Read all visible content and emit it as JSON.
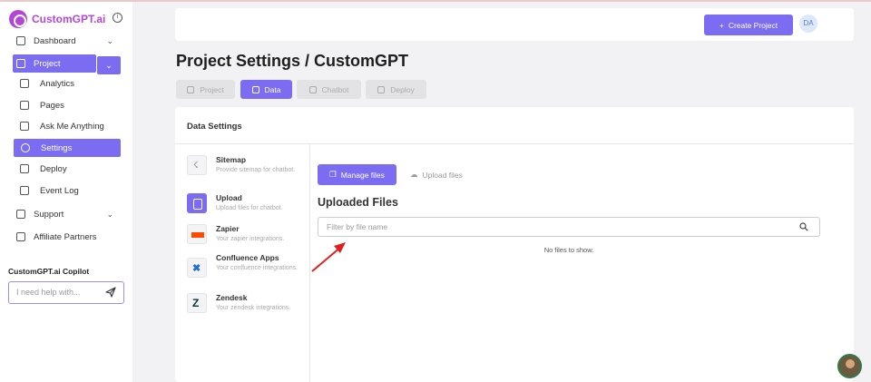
{
  "brand": {
    "name": "CustomGPT.ai"
  },
  "sidebar": {
    "items": [
      {
        "label": "Dashboard",
        "icon": "home-icon"
      },
      {
        "label": "Project",
        "icon": "clipboard-icon"
      },
      {
        "label": "Analytics",
        "icon": "bar-chart-icon"
      },
      {
        "label": "Pages",
        "icon": "database-icon"
      },
      {
        "label": "Ask Me Anything",
        "icon": "chat-icon"
      },
      {
        "label": "Settings",
        "icon": "gear-icon"
      },
      {
        "label": "Deploy",
        "icon": "rocket-icon"
      },
      {
        "label": "Event Log",
        "icon": "calendar-icon"
      },
      {
        "label": "Support",
        "icon": "headset-icon"
      },
      {
        "label": "Affiliate Partners",
        "icon": "handshake-icon"
      }
    ],
    "active": "Settings"
  },
  "copilot": {
    "title": "CustomGPT.ai Copilot",
    "placeholder": "I need help with..."
  },
  "topbar": {
    "create_label": "Create Project",
    "avatar_initials": "DA"
  },
  "page": {
    "title": "Project Settings / CustomGPT"
  },
  "tabs": [
    {
      "label": "Project",
      "active": false
    },
    {
      "label": "Data",
      "active": true
    },
    {
      "label": "Chatbot",
      "active": false
    },
    {
      "label": "Deploy",
      "active": false
    }
  ],
  "data_settings": {
    "title": "Data Settings",
    "sources": [
      {
        "name": "Sitemap",
        "desc": "Provide sitemap for chatbot."
      },
      {
        "name": "Upload",
        "desc": "Upload files for chatbot."
      },
      {
        "name": "Zapier",
        "desc": "Your zapier integrations."
      },
      {
        "name": "Confluence Apps",
        "desc": "Your confluence integrations."
      },
      {
        "name": "Zendesk",
        "desc": "Your zendesk integrations."
      }
    ]
  },
  "files": {
    "manage_label": "Manage files",
    "upload_label": "Upload files",
    "section_title": "Uploaded Files",
    "filter_placeholder": "Filter by file name",
    "empty_text": "No files to show."
  },
  "colors": {
    "accent": "#7b6cf2",
    "brand": "#b545d6"
  }
}
